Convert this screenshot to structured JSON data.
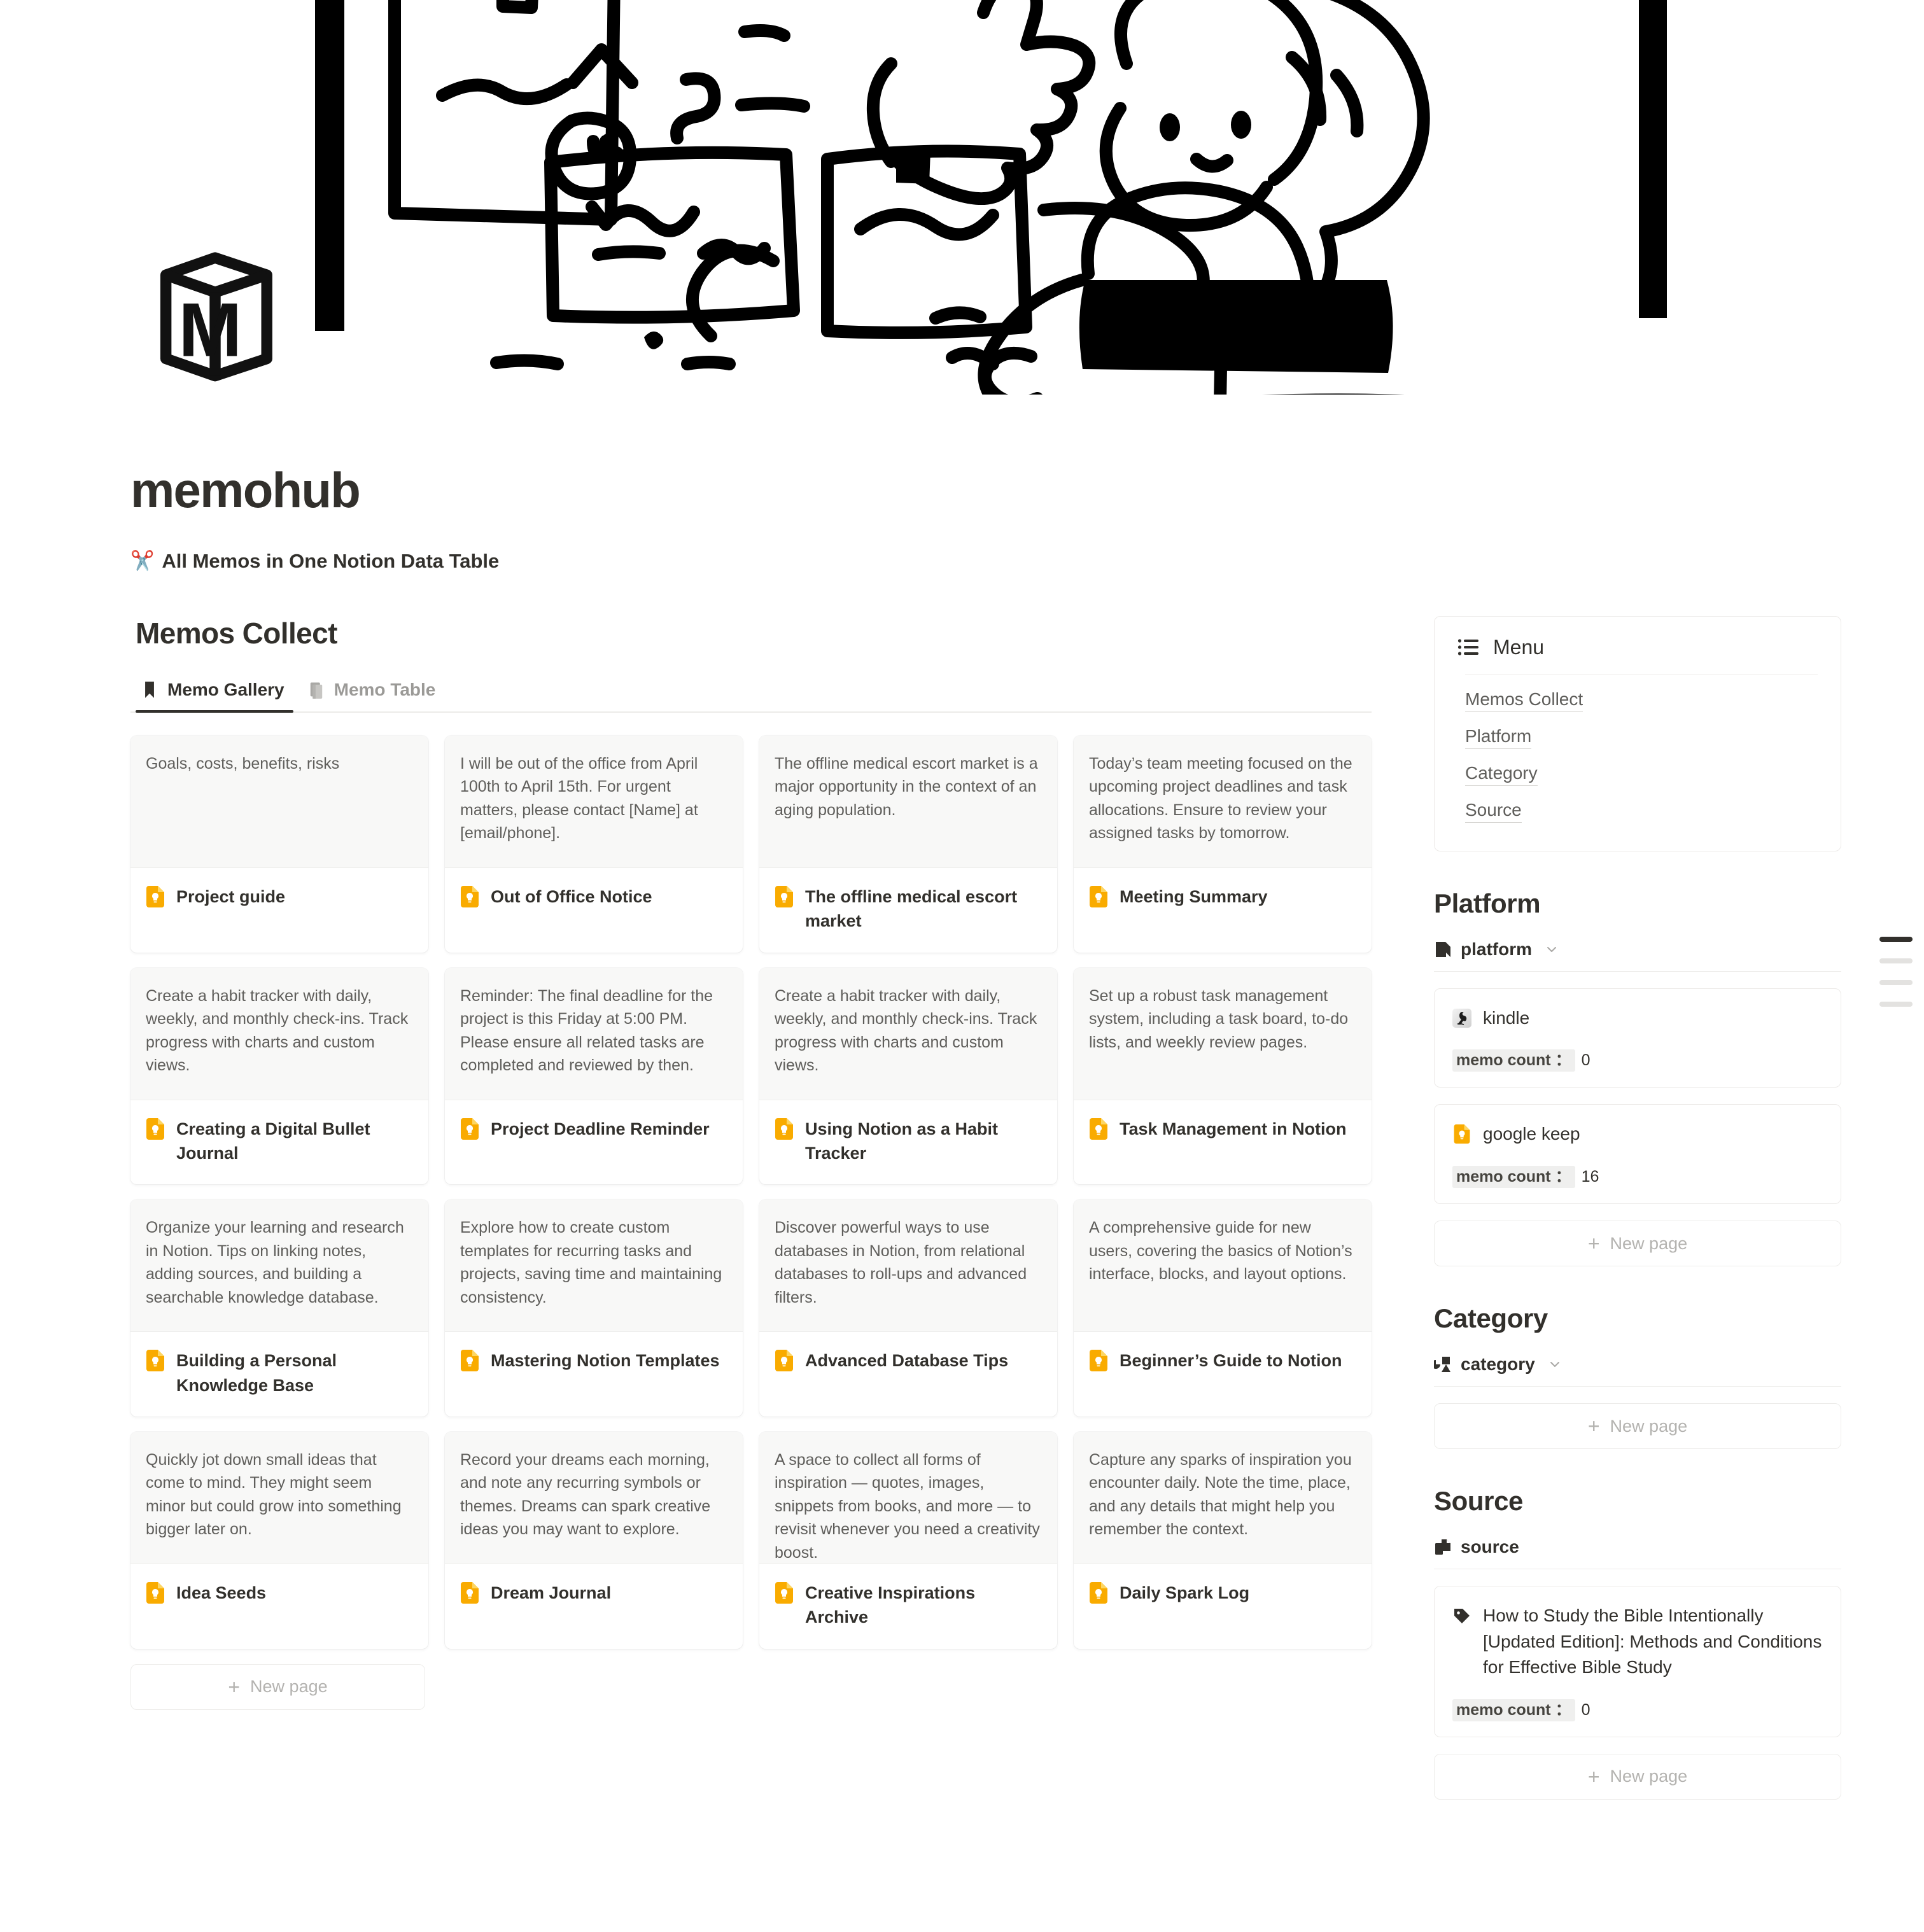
{
  "cover": {
    "logo_letter": "M",
    "alt": "hand-drawn doodle of a person at a desk with notes and sticky papers"
  },
  "header": {
    "title": "memohub",
    "subtitle_emoji": "✂️",
    "subtitle": "All Memos in One Notion Data Table"
  },
  "database": {
    "title": "Memos Collect",
    "tabs": [
      {
        "label": "Memo Gallery",
        "icon": "bookmark-icon",
        "active": true
      },
      {
        "label": "Memo Table",
        "icon": "books-icon",
        "active": false
      }
    ],
    "new_page_label": "New page",
    "cards": [
      {
        "preview": "Goals, costs, benefits, risks",
        "title": "Project guide",
        "icon": "google-keep-icon"
      },
      {
        "preview": "I will be out of the office from April 100th to April 15th. For urgent matters, please contact [Name] at [email/phone].",
        "title": "Out of Office Notice",
        "icon": "google-keep-icon"
      },
      {
        "preview": "The offline medical escort market is a major opportunity in the context of an aging population.",
        "title": "The offline medical escort market",
        "icon": "google-keep-icon"
      },
      {
        "preview": "Today’s team meeting focused on the upcoming project deadlines and task allocations. Ensure to review your assigned tasks by tomorrow.",
        "title": "Meeting Summary",
        "icon": "google-keep-icon"
      },
      {
        "preview": "Create a habit tracker with daily, weekly, and monthly check-ins. Track progress with charts and custom views.",
        "title": "Creating a Digital Bullet Journal",
        "icon": "google-keep-icon"
      },
      {
        "preview": "Reminder: The final deadline for the project is this Friday at 5:00 PM. Please ensure all related tasks are completed and reviewed by then.",
        "title": "Project Deadline Reminder",
        "icon": "google-keep-icon"
      },
      {
        "preview": "Create a habit tracker with daily, weekly, and monthly check-ins. Track progress with charts and custom views.",
        "title": "Using Notion as a Habit Tracker",
        "icon": "google-keep-icon"
      },
      {
        "preview": "Set up a robust task management system, including a task board, to-do lists, and weekly review pages.",
        "title": "Task Management in Notion",
        "icon": "google-keep-icon"
      },
      {
        "preview": "Organize your learning and research in Notion. Tips on linking notes, adding sources, and building a searchable knowledge database.",
        "title": "Building a Personal Knowledge Base",
        "icon": "google-keep-icon"
      },
      {
        "preview": "Explore how to create custom templates for recurring tasks and projects, saving time and maintaining consistency.",
        "title": "Mastering Notion Templates",
        "icon": "google-keep-icon"
      },
      {
        "preview": "Discover powerful ways to use databases in Notion, from relational databases to roll-ups and advanced filters.",
        "title": "Advanced Database Tips",
        "icon": "google-keep-icon"
      },
      {
        "preview": "A comprehensive guide for new users, covering the basics of Notion’s interface, blocks, and layout options.",
        "title": "Beginner’s Guide to Notion",
        "icon": "google-keep-icon"
      },
      {
        "preview": "Quickly jot down small ideas that come to mind. They might seem minor but could grow into something bigger later on.",
        "title": "Idea Seeds",
        "icon": "google-keep-icon"
      },
      {
        "preview": "Record your dreams each morning, and note any recurring symbols or themes. Dreams can spark creative ideas you may want to explore.",
        "title": "Dream Journal",
        "icon": "google-keep-icon"
      },
      {
        "preview": "A space to collect all forms of inspiration — quotes, images, snippets from books, and more — to revisit whenever you need a creativity boost.",
        "title": "Creative Inspirations Archive",
        "icon": "google-keep-icon"
      },
      {
        "preview": "Capture any sparks of inspiration you encounter daily. Note the time, place, and any details that might help you remember the context.",
        "title": "Daily Spark Log",
        "icon": "google-keep-icon"
      }
    ]
  },
  "toc": {
    "bars": [
      {
        "active": true,
        "width": 52
      },
      {
        "active": false,
        "width": 52
      },
      {
        "active": false,
        "width": 52
      },
      {
        "active": false,
        "width": 52
      }
    ]
  },
  "sidebar": {
    "menu": {
      "icon": "bulleted-list-icon",
      "title": "Menu",
      "links": [
        {
          "label": "Memos Collect"
        },
        {
          "label": "Platform"
        },
        {
          "label": "Category"
        },
        {
          "label": "Source"
        }
      ]
    },
    "sections": [
      {
        "heading": "Platform",
        "db_name": "platform",
        "db_icon": "page-corner-icon",
        "has_chevron": true,
        "items": [
          {
            "icon": "kindle-icon",
            "title": "kindle",
            "count_label": "memo count ：",
            "count": "0"
          },
          {
            "icon": "google-keep-icon",
            "title": "google keep",
            "count_label": "memo count ：",
            "count": "16"
          }
        ],
        "new_page_label": "New page"
      },
      {
        "heading": "Category",
        "db_name": "category",
        "db_icon": "shapes-icon",
        "has_chevron": true,
        "items": [],
        "new_page_label": "New page"
      },
      {
        "heading": "Source",
        "db_name": "source",
        "db_icon": "copy-pages-icon",
        "has_chevron": false,
        "items": [
          {
            "icon": "tag-icon",
            "title": "How to Study the Bible Intentionally [Updated Edition]: Methods and Conditions for Effective Bible Study",
            "count_label": "memo count ：",
            "count": "0"
          }
        ],
        "new_page_label": "New page"
      }
    ]
  }
}
